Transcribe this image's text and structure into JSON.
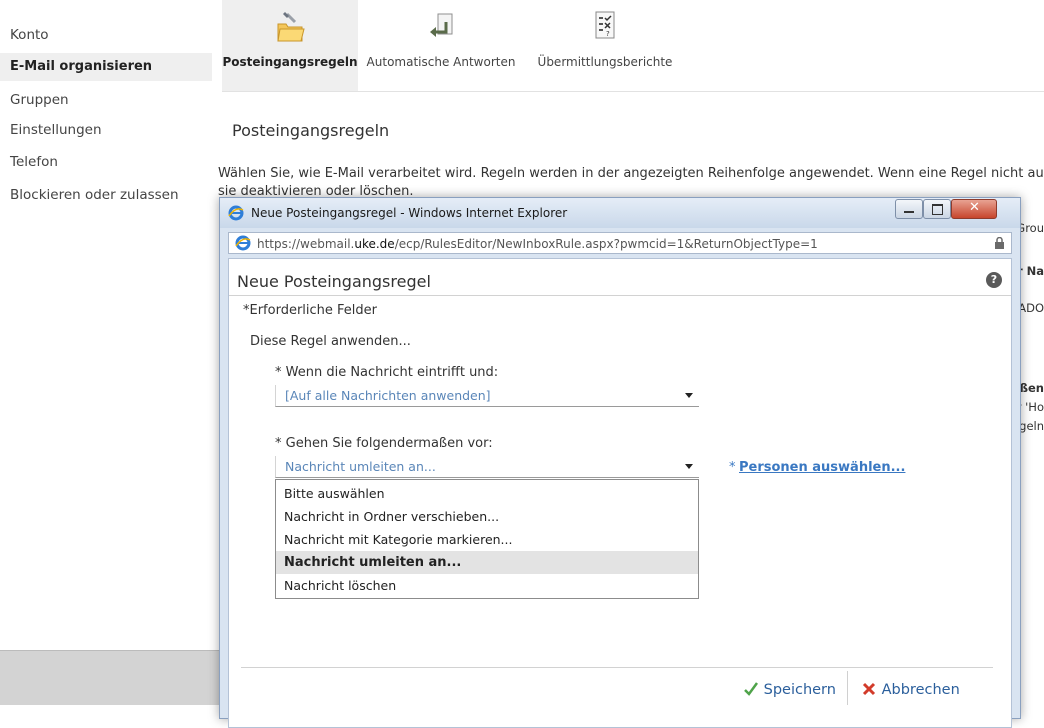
{
  "nav": {
    "items": [
      {
        "label": "Konto"
      },
      {
        "label": "E-Mail organisieren"
      },
      {
        "label": "Gruppen"
      },
      {
        "label": "Einstellungen"
      },
      {
        "label": "Telefon"
      },
      {
        "label": "Blockieren oder zulassen"
      }
    ]
  },
  "ribbon": {
    "tabs": [
      {
        "label": "Posteingangsregeln"
      },
      {
        "label": "Automatische Antworten"
      },
      {
        "label": "Übermittlungsberichte"
      }
    ]
  },
  "page": {
    "heading": "Posteingangsregeln",
    "description_line1": "Wählen Sie, wie E-Mail verarbeitet wird. Regeln werden in der angezeigten Reihenfolge angewendet. Wenn eine Regel nicht au",
    "description_line2": "sie deaktivieren oder löschen.",
    "bg_fragments": [
      "Grou",
      "r Na",
      "ADO",
      "ßen",
      "r 'Ho",
      "geln"
    ]
  },
  "browser": {
    "title": "Neue Posteingangsregel - Windows Internet Explorer",
    "url_prefix": "https://webmail.",
    "url_domain": "uke.de",
    "url_rest": "/ecp/RulesEditor/NewInboxRule.aspx?pwmcid=1&ReturnObjectType=1"
  },
  "dialog": {
    "title": "Neue Posteingangsregel",
    "help": "?",
    "required_note": "*Erforderliche Felder",
    "section_label": "Diese Regel anwenden...",
    "condition_label": "* Wenn die Nachricht eintrifft und:",
    "condition_value": "[Auf alle Nachrichten anwenden]",
    "action_label": "* Gehen Sie folgendermaßen vor:",
    "action_value": "Nachricht umleiten an...",
    "people_star": "*",
    "people_link": "Personen auswählen...",
    "action_options": [
      {
        "label": "Bitte auswählen"
      },
      {
        "label": "Nachricht in Ordner verschieben..."
      },
      {
        "label": "Nachricht mit Kategorie markieren..."
      },
      {
        "label": "Nachricht umleiten an..."
      },
      {
        "label": "Nachricht löschen"
      }
    ],
    "selected_option": "Nachricht umleiten an...",
    "save_label": "Speichern",
    "cancel_label": "Abbrechen"
  },
  "colors": {
    "accent_link": "#3a78c2",
    "save_check": "#4fa34a",
    "cancel_x": "#d23b2a"
  }
}
